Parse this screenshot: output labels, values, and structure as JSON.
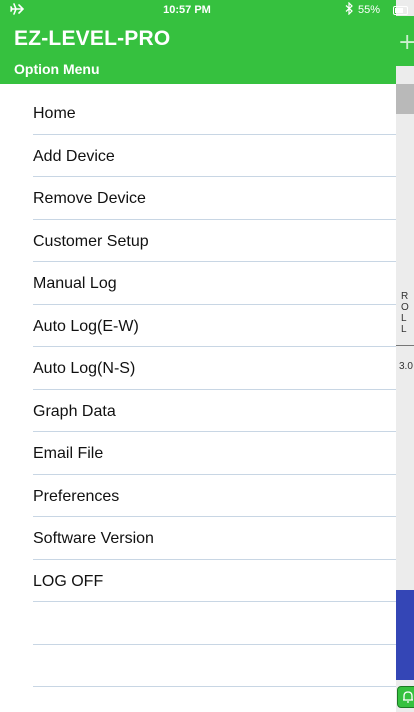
{
  "status_bar": {
    "time": "10:57 PM",
    "battery_percent": "55%",
    "icons": [
      "airplane-icon",
      "bluetooth-icon",
      "battery-icon"
    ]
  },
  "header": {
    "app_title": "EZ-LEVEL-PRO",
    "subtitle": "Option Menu",
    "color": "#36c13f"
  },
  "menu": {
    "items": [
      {
        "label": "Home"
      },
      {
        "label": "Add Device"
      },
      {
        "label": "Remove Device"
      },
      {
        "label": "Customer Setup"
      },
      {
        "label": "Manual Log"
      },
      {
        "label": "Auto Log(E-W)"
      },
      {
        "label": "Auto Log(N-S)"
      },
      {
        "label": "Graph Data"
      },
      {
        "label": "Email File"
      },
      {
        "label": "Preferences"
      },
      {
        "label": "Software Version"
      },
      {
        "label": "LOG OFF"
      }
    ],
    "divider_color": "#c8d6e4"
  },
  "background_screen": {
    "column_letters": "R O L L",
    "value_partial": "3.0",
    "accent_blue": "#3446b6"
  }
}
